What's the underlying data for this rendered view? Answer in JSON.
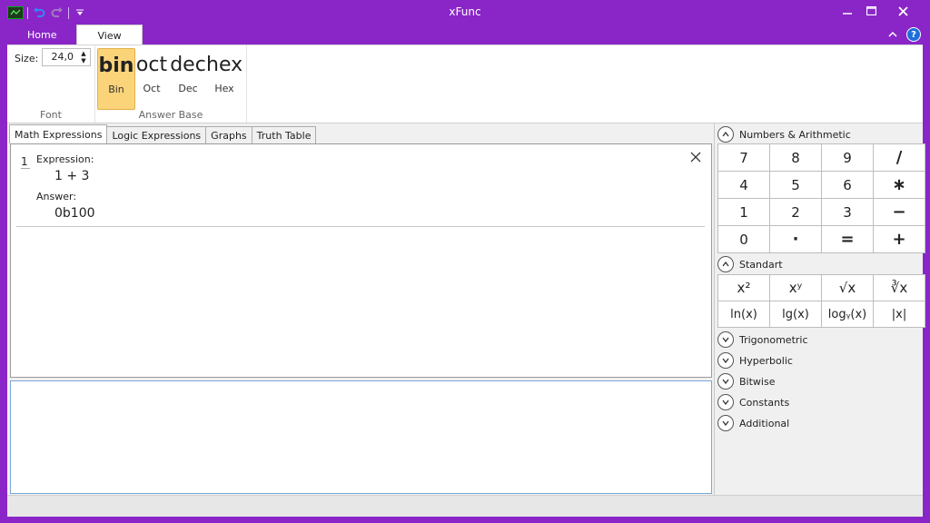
{
  "window": {
    "title": "xFunc"
  },
  "ribbon_tabs": [
    {
      "label": "Home"
    },
    {
      "label": "View"
    }
  ],
  "font_group": {
    "size_label": "Size:",
    "size_value": "24,0",
    "label": "Font"
  },
  "answer_base": {
    "label": "Answer Base",
    "buttons": [
      {
        "big": "bin",
        "small": "Bin",
        "selected": true
      },
      {
        "big": "oct",
        "small": "Oct"
      },
      {
        "big": "dec",
        "small": "Dec"
      },
      {
        "big": "hex",
        "small": "Hex"
      }
    ]
  },
  "doc_tabs": [
    {
      "label": "Math Expressions",
      "active": true
    },
    {
      "label": "Logic Expressions"
    },
    {
      "label": "Graphs"
    },
    {
      "label": "Truth Table"
    }
  ],
  "expressions": [
    {
      "number": "1",
      "expression_label": "Expression:",
      "expression": "1 + 3",
      "answer_label": "Answer:",
      "answer": "0b100"
    }
  ],
  "input": {
    "value": ""
  },
  "categories": {
    "numbers": {
      "label": "Numbers & Arithmetic",
      "keys": [
        "7",
        "8",
        "9",
        "/",
        "4",
        "5",
        "6",
        "∗",
        "1",
        "2",
        "3",
        "−",
        "0",
        "·",
        "=",
        "+"
      ]
    },
    "standart": {
      "label": "Standart",
      "keys": [
        "x²",
        "xʸ",
        "√x",
        "∛x",
        "ln(x)",
        "lg(x)",
        "logᵧ(x)",
        "|x|"
      ]
    },
    "collapsed": [
      "Trigonometric",
      "Hyperbolic",
      "Bitwise",
      "Constants",
      "Additional"
    ]
  },
  "colors": {
    "accent": "#8a26c8",
    "selected": "#fbd47a",
    "help": "#1e6fd9"
  }
}
